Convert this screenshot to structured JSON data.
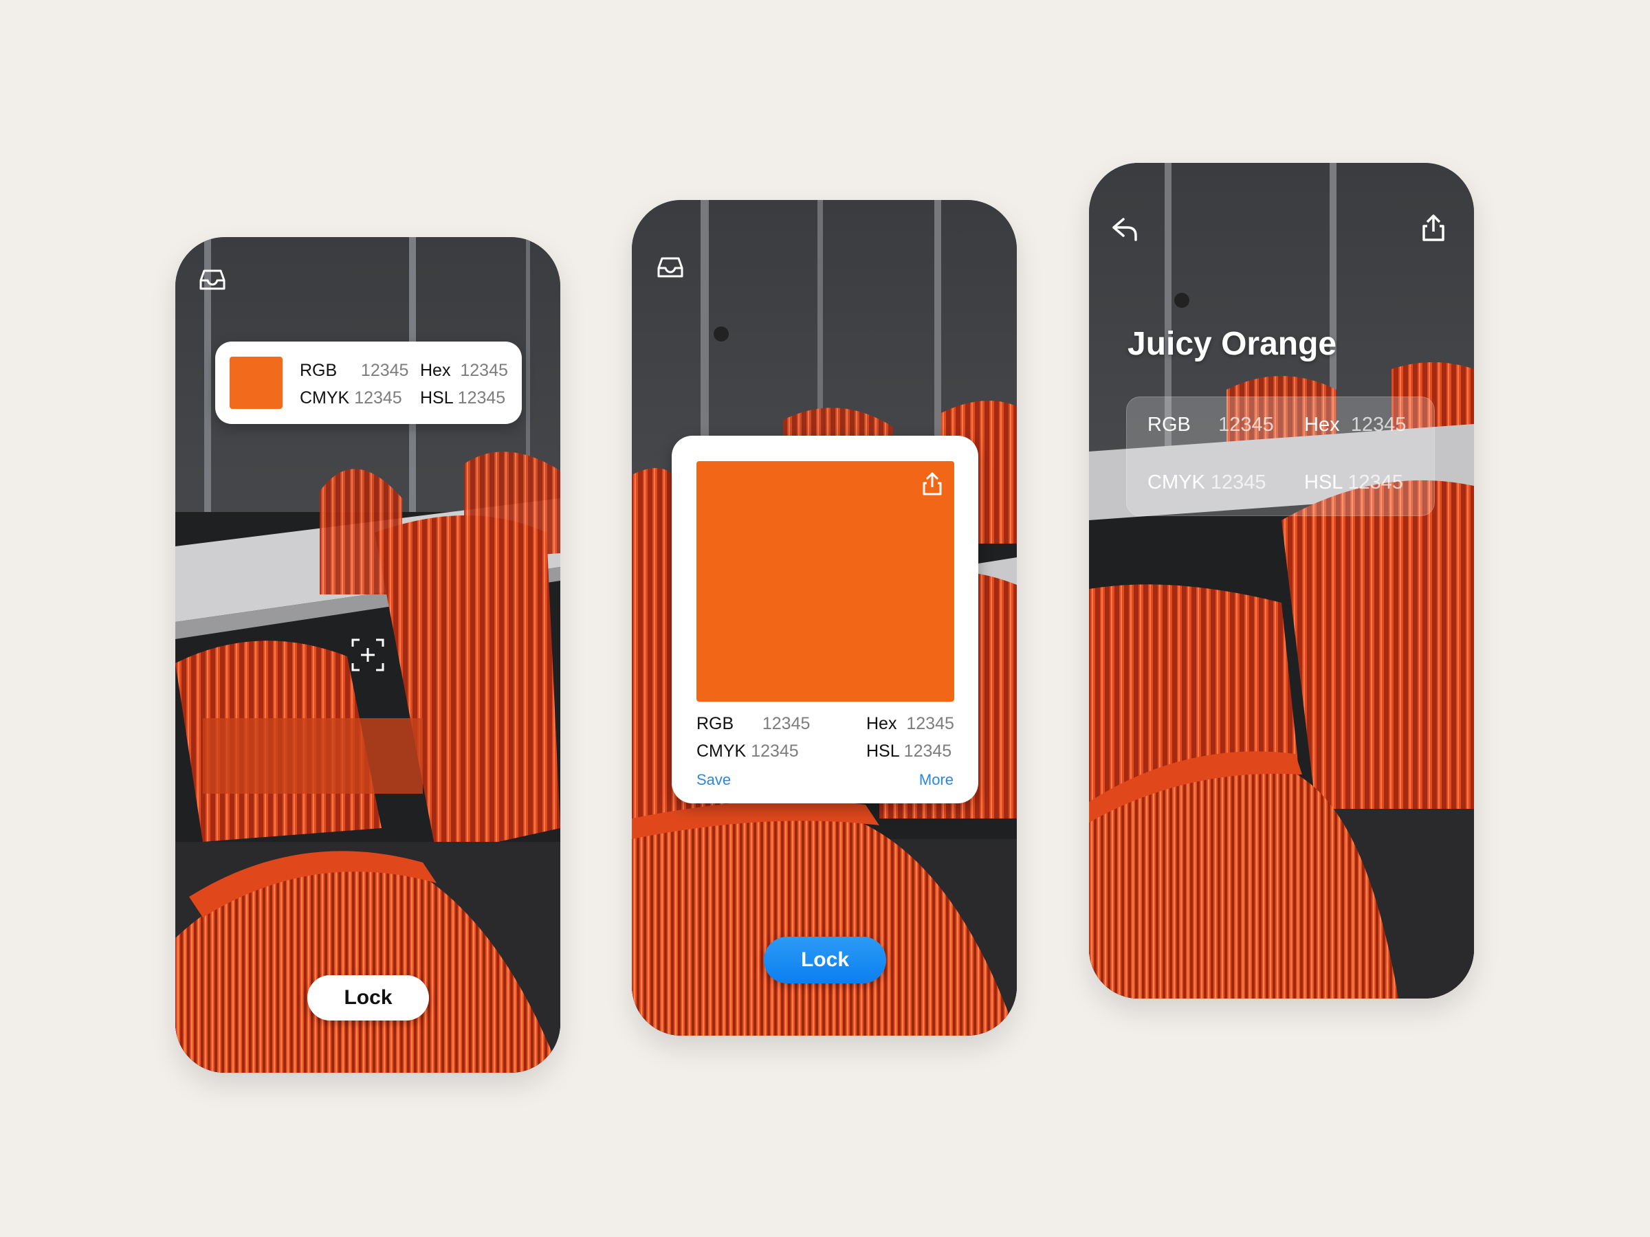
{
  "colors": {
    "background": "#f2efeb",
    "swatch": "#f26617",
    "accent_blue": "#1a8cf2",
    "link_blue": "#2d86e0"
  },
  "screen1": {
    "top_icon": "inbox-tray-icon",
    "info": {
      "rgb_label": "RGB",
      "rgb_value": "12345",
      "hex_label": "Hex",
      "hex_value": "12345",
      "cmyk_label": "CMYK",
      "cmyk_value": "12345",
      "hsl_label": "HSL",
      "hsl_value": "12345"
    },
    "reticle_icon": "add-focus-reticle-icon",
    "lock_label": "Lock"
  },
  "screen2": {
    "top_icon": "inbox-tray-icon",
    "card": {
      "share_icon": "share-icon",
      "rgb_label": "RGB",
      "rgb_value": "12345",
      "hex_label": "Hex",
      "hex_value": "12345",
      "cmyk_label": "CMYK",
      "cmyk_value": "12345",
      "hsl_label": "HSL",
      "hsl_value": "12345",
      "save_label": "Save",
      "more_label": "More"
    },
    "lock_label": "Lock"
  },
  "screen3": {
    "back_icon": "back-arrow-icon",
    "share_icon": "share-icon",
    "color_name": "Juicy Orange",
    "info": {
      "rgb_label": "RGB",
      "rgb_value": "12345",
      "hex_label": "Hex",
      "hex_value": "12345",
      "cmyk_label": "CMYK",
      "cmyk_value": "12345",
      "hsl_label": "HSL",
      "hsl_value": "12345"
    }
  }
}
